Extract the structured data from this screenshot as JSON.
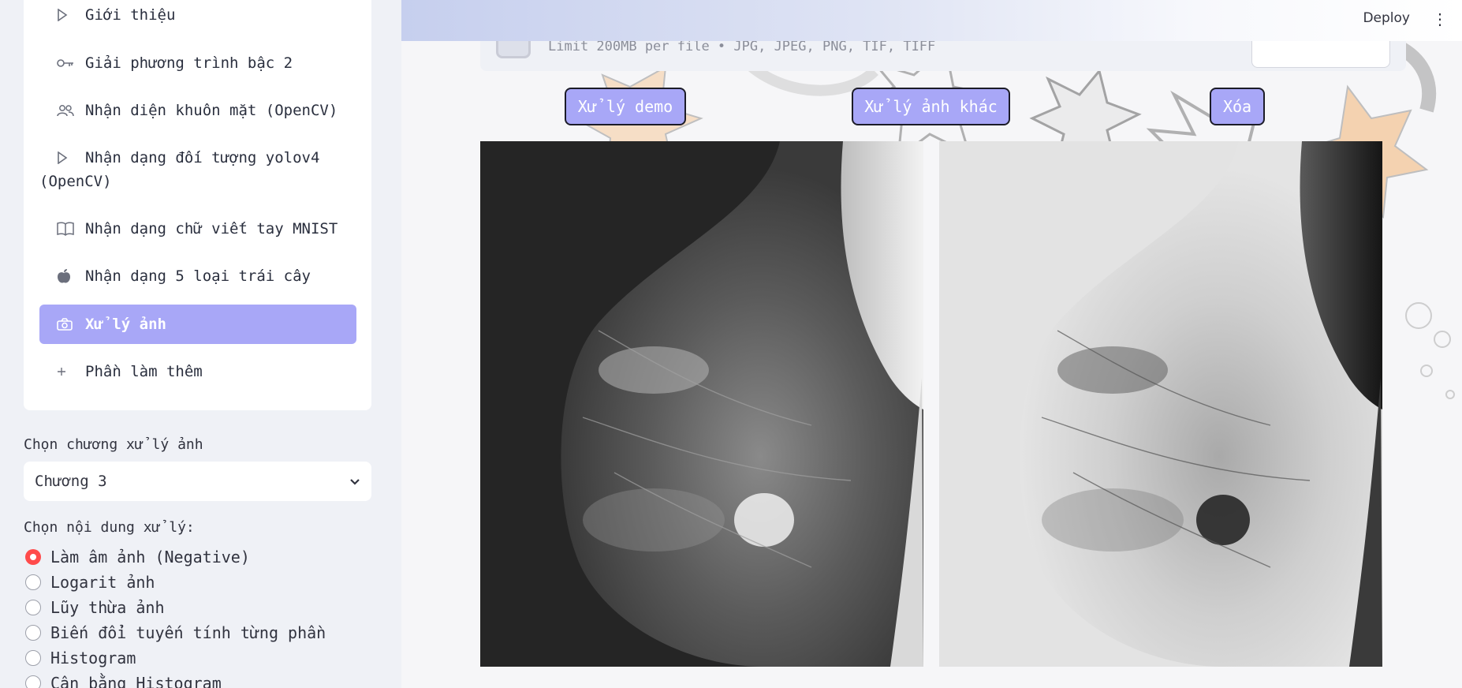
{
  "sidebar": {
    "menu": [
      {
        "label": "Giới thiệu",
        "icon": "play-outline-icon"
      },
      {
        "label": "Giải phương trình bậc 2",
        "icon": "key-icon"
      },
      {
        "label": "Nhận diện khuôn mặt (OpenCV)",
        "icon": "people-icon"
      },
      {
        "label_line1": "Nhận dạng đối tượng yolov4",
        "label_line2": "(OpenCV)",
        "icon": "play-outline-icon"
      },
      {
        "label": "Nhận dạng chữ viết tay MNIST",
        "icon": "book-icon"
      },
      {
        "label": "Nhận dạng 5 loại trái cây",
        "icon": "apple-icon"
      },
      {
        "label": "Xử lý ảnh",
        "icon": "camera-icon",
        "active": true
      },
      {
        "label": "Phần làm thêm",
        "icon": "plus-icon"
      }
    ],
    "chapter_label": "Chọn chương xử lý ảnh",
    "chapter_value": "Chương 3",
    "content_label": "Chọn nội dung xử lý:",
    "options": [
      {
        "label": "Làm âm ảnh (Negative)",
        "checked": true
      },
      {
        "label": "Logarit ảnh"
      },
      {
        "label": "Lũy thừa ảnh"
      },
      {
        "label": "Biến đổi tuyến tính từng phần"
      },
      {
        "label": "Histogram"
      },
      {
        "label": "Cân bằng Histogram"
      }
    ]
  },
  "header": {
    "deploy": "Deploy",
    "menu_icon": "⋮"
  },
  "uploader": {
    "limit_text": "Limit 200MB per file • JPG, JPEG, PNG, TIF, TIFF"
  },
  "actions": {
    "demo": "Xử lý demo",
    "other": "Xử lý ảnh khác",
    "delete": "Xóa"
  },
  "images": {
    "original": "original-mammogram-image",
    "processed": "negative-mammogram-image"
  },
  "colors": {
    "accent": "#a8a7f7",
    "radio_checked": "#ff4b4b",
    "sidebar_bg": "#eff1f6"
  }
}
